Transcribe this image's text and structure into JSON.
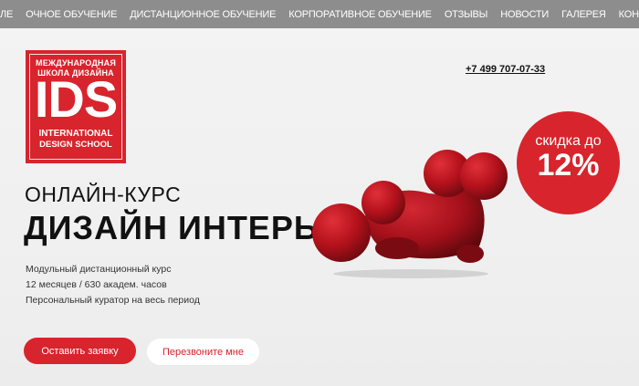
{
  "nav": {
    "items": [
      "О ШКОЛЕ",
      "ОЧНОЕ ОБУЧЕНИЕ",
      "ДИСТАНЦИОННОЕ ОБУЧЕНИЕ",
      "КОРПОРАТИВНОЕ ОБУЧЕНИЕ",
      "ОТЗЫВЫ",
      "НОВОСТИ",
      "ГАЛЕРЕЯ",
      "КОНТАКТЫ"
    ]
  },
  "logo": {
    "line1": "МЕЖДУНАРОДНАЯ",
    "line2": "ШКОЛА ДИЗАЙНА",
    "mark": "IDS",
    "line3": "INTERNATIONAL",
    "line4": "DESIGN SCHOOL"
  },
  "phone": "+7 499 707-07-33",
  "hero": {
    "subtitle": "ОНЛАЙН-КУРС",
    "title": "ДИЗАЙН ИНТЕРЬЕРА",
    "details": [
      "Модульный дистанционный курс",
      "12 месяцев / 630 академ. часов",
      "Персональный куратор на весь период"
    ]
  },
  "buttons": {
    "apply": "Оставить заявку",
    "callback": "Перезвоните мне"
  },
  "discount": {
    "line1": "скидка до",
    "line2": "12%"
  },
  "colors": {
    "brand_red": "#d8242c",
    "nav_bg": "#8d8d8d"
  },
  "icons": {
    "chair": "red-armchair-image"
  }
}
